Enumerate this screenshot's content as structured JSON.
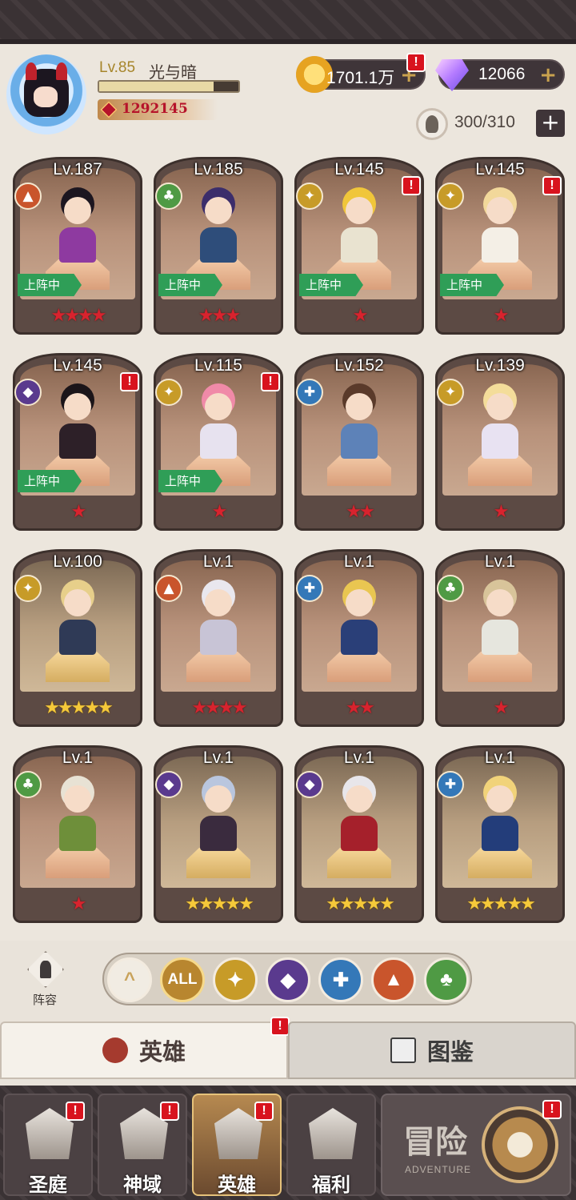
{
  "player": {
    "level": "Lv.85",
    "name": "光与暗",
    "exp_fraction": 0.82,
    "power": "1292145"
  },
  "resources": {
    "gold": "1701.1万",
    "gems": "12066",
    "capacity": "300/310"
  },
  "heroes": [
    {
      "level": "Lv.187",
      "faction": "fire",
      "stars": 4,
      "star_color": "red",
      "deployed": true,
      "alert": false,
      "hair": "#1c1620",
      "body": "#8e3aa0"
    },
    {
      "level": "Lv.185",
      "faction": "tree",
      "stars": 3,
      "star_color": "red",
      "deployed": true,
      "alert": false,
      "hair": "#3b2d6b",
      "body": "#2e4d7a"
    },
    {
      "level": "Lv.145",
      "faction": "light",
      "stars": 1,
      "star_color": "red",
      "deployed": true,
      "alert": true,
      "hair": "#f0c63a",
      "body": "#e9e3d0"
    },
    {
      "level": "Lv.145",
      "faction": "light",
      "stars": 1,
      "star_color": "red",
      "deployed": true,
      "alert": true,
      "hair": "#f2d89a",
      "body": "#f4efe6"
    },
    {
      "level": "Lv.145",
      "faction": "dark",
      "stars": 1,
      "star_color": "red",
      "deployed": true,
      "alert": true,
      "hair": "#1b1519",
      "body": "#2d2028"
    },
    {
      "level": "Lv.115",
      "faction": "light",
      "stars": 1,
      "star_color": "red",
      "deployed": true,
      "alert": true,
      "hair": "#f08aa8",
      "body": "#e7e2ef"
    },
    {
      "level": "Lv.152",
      "faction": "water",
      "stars": 2,
      "star_color": "red",
      "deployed": false,
      "alert": false,
      "hair": "#5a3a2a",
      "body": "#5d82b8"
    },
    {
      "level": "Lv.139",
      "faction": "light",
      "stars": 1,
      "star_color": "red",
      "deployed": false,
      "alert": false,
      "hair": "#f4dd9a",
      "body": "#e8e2f2"
    },
    {
      "level": "Lv.100",
      "faction": "light",
      "stars": 5,
      "star_color": "yellow",
      "deployed": false,
      "alert": false,
      "hair": "#e7cf8a",
      "body": "#2f3a56"
    },
    {
      "level": "Lv.1",
      "faction": "fire",
      "stars": 4,
      "star_color": "red",
      "deployed": false,
      "alert": false,
      "hair": "#e9e7ee",
      "body": "#c8c4d6"
    },
    {
      "level": "Lv.1",
      "faction": "water",
      "stars": 2,
      "star_color": "red",
      "deployed": false,
      "alert": false,
      "hair": "#e9c651",
      "body": "#2a3f78"
    },
    {
      "level": "Lv.1",
      "faction": "tree",
      "stars": 1,
      "star_color": "red",
      "deployed": false,
      "alert": false,
      "hair": "#d8c49a",
      "body": "#e6e6de"
    },
    {
      "level": "Lv.1",
      "faction": "tree",
      "stars": 1,
      "star_color": "red",
      "deployed": false,
      "alert": false,
      "hair": "#e8e2d4",
      "body": "#6e8f3a"
    },
    {
      "level": "Lv.1",
      "faction": "dark",
      "stars": 5,
      "star_color": "yellow",
      "deployed": false,
      "alert": false,
      "hair": "#b9c6de",
      "body": "#3a2b3e"
    },
    {
      "level": "Lv.1",
      "faction": "dark",
      "stars": 5,
      "star_color": "yellow",
      "deployed": false,
      "alert": false,
      "hair": "#e8e6ea",
      "body": "#a5202b"
    },
    {
      "level": "Lv.1",
      "faction": "water",
      "stars": 5,
      "star_color": "yellow",
      "deployed": false,
      "alert": false,
      "hair": "#f1d37a",
      "body": "#233d7a"
    }
  ],
  "deployed_label": "上阵中",
  "formation_label": "阵容",
  "filters": [
    {
      "id": "up",
      "label": "^"
    },
    {
      "id": "all",
      "label": "ALL"
    },
    {
      "id": "light",
      "label": "✦"
    },
    {
      "id": "dark",
      "label": "◆"
    },
    {
      "id": "water",
      "label": "✚"
    },
    {
      "id": "fire",
      "label": "▲"
    },
    {
      "id": "tree",
      "label": "♣"
    }
  ],
  "tabs": {
    "heroes": "英雄",
    "codex": "图鉴"
  },
  "nav": [
    {
      "label": "圣庭",
      "alert": true,
      "active": false
    },
    {
      "label": "神域",
      "alert": true,
      "active": false
    },
    {
      "label": "英雄",
      "alert": true,
      "active": true
    },
    {
      "label": "福利",
      "alert": false,
      "active": false
    }
  ],
  "adventure": {
    "title": "冒险",
    "subtitle": "ADVENTURE"
  },
  "alert_mark": "!",
  "colors": {
    "accent_red": "#d8131e",
    "gold": "#c9a24e"
  }
}
